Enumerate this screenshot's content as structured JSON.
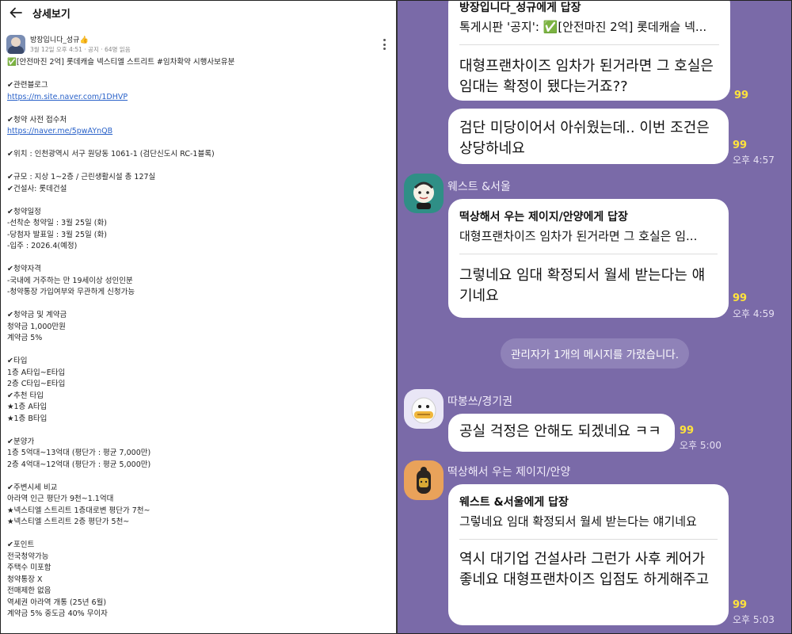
{
  "left": {
    "title": "상세보기",
    "author": "방장입니다_성규👍",
    "sub": "3월 12일 오후 4:51 · 공지 · 64명 읽음",
    "lines": [
      "✅[안전마진 2억] 롯데캐슬 넥스티엘 스트리트 #임차확약 시행사보유분",
      "",
      "✔관련블로그",
      "https://m.site.naver.com/1DHVP",
      "",
      "✔청약 사전 접수처",
      "https://naver.me/5pwAYnQB",
      "",
      "✔위치 : 인천광역시 서구 원당동 1061-1 (검단신도시 RC-1블록)",
      "",
      "✔규모 : 지상 1~2층 / 근린생활시설 총 127실",
      "✔건설사: 롯데건설",
      "",
      "✔청약일정",
      "-선착순 청약일 : 3월 25일 (화)",
      "-당첨자 발표일 : 3월 25일 (화)",
      "-입주 : 2026.4(예정)",
      "",
      "✔청약자격",
      "-국내에 거주하는 만 19세이상 성인인분",
      "-청약통장 가입여부와 무관하게 신청가능",
      "",
      "✔청약금 및 계약금",
      "청약금 1,000만원",
      "계약금 5%",
      "",
      "✔타입",
      "1층 A타입~E타입",
      "2층 C타입~E타입",
      "✔추천 타입",
      "★1층 A타입",
      "★1층 B타입",
      "",
      "✔분양가",
      "1층 5억대~13억대 (평단가 : 평균 7,000만)",
      "2층 4억대~12억대 (평단가 : 평균 5,000만)",
      "",
      "✔주변시세 비교",
      "아라역 인근 평단가 9천~1.1억대",
      "★넥스티엘 스트리트 1층대로변 평단가 7천~",
      "★넥스티엘 스트리트 2층 평단가 5천~",
      "",
      "✔포인트",
      "전국청약가능",
      "주택수 미포함",
      "청약통장 X",
      "전매제한 없음",
      "역세권 아라역 개통 (25년 6월)",
      "계약금 5% 중도금 40% 무이자"
    ]
  },
  "right": {
    "m1": {
      "reply_title": "방장입니다_성규에게 답장",
      "reply_text": "톡게시판 '공지': ✅[안전마진 2억] 롯데캐슬 넥...",
      "text": "대형프랜차이즈 임차가 된거라면 그 호실은 임대는 확정이 됐다는거죠??",
      "count": "99"
    },
    "m2": {
      "text": "검단 미당이어서 아쉬웠는데.. 이번 조건은 상당하네요",
      "count": "99",
      "time": "오후 4:57"
    },
    "m3": {
      "name": "웨스트 &서울",
      "reply_title": "떡상해서 우는 제이지/안양에게 답장",
      "reply_text": "대형프랜차이즈 임차가 된거라면 그 호실은 임...",
      "text": "그렇네요 임대 확정되서 월세 받는다는 얘기네요",
      "count": "99",
      "time": "오후 4:59"
    },
    "notice": "관리자가 1개의 메시지를 가렸습니다.",
    "m4": {
      "name": "따봉쓰/경기권",
      "text": "공실 걱정은 안해도 되겠네요 ㅋㅋ",
      "count": "99",
      "time": "오후 5:00"
    },
    "m5": {
      "name": "떡상해서 우는 제이지/안양",
      "reply_title": "웨스트 &서울에게 답장",
      "reply_text": "그렇네요 임대 확정되서 월세 받는다는 얘기네요",
      "text": "역시 대기업 건설사라 그런가 사후 케어가 좋네요 대형프랜차이즈 입점도 하게해주고",
      "count": "99",
      "time": "오후 5:03"
    }
  }
}
